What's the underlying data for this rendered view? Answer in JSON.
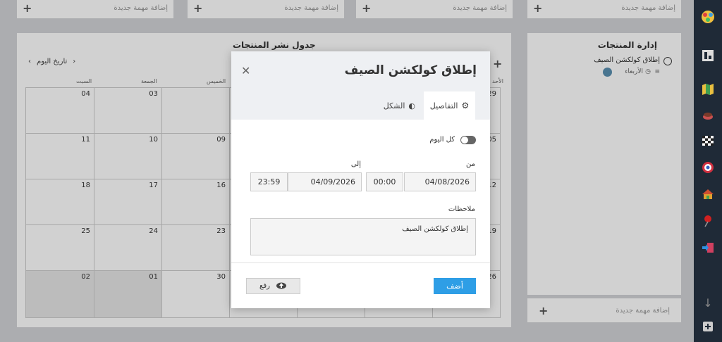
{
  "top_cards": [
    {
      "add_label": "إضافة مهمة جديدة"
    },
    {
      "add_label": "إضافة مهمة جديدة"
    },
    {
      "add_label": "إضافة مهمة جديدة"
    },
    {
      "add_label": "إضافة مهمة جديدة"
    }
  ],
  "calendar": {
    "title": "جدول نشر المنتجات",
    "today_label": "تاريخ اليوم",
    "day_headers": [
      "السبت",
      "الجمعة",
      "الخميس",
      "الأحد"
    ],
    "dates": [
      [
        "04",
        "03",
        "",
        "",
        "",
        "",
        "29"
      ],
      [
        "11",
        "10",
        "09",
        "",
        "",
        "",
        "05"
      ],
      [
        "18",
        "17",
        "16",
        "",
        "",
        "",
        "12"
      ],
      [
        "25",
        "24",
        "23",
        "",
        "",
        "",
        "19"
      ],
      [
        "02",
        "01",
        "30",
        "",
        "",
        "",
        "26"
      ]
    ]
  },
  "product_management": {
    "title": "إدارة المنتجات",
    "task": {
      "title": "إطلاق كولكشن الصيف",
      "meta": "الأربعاء"
    },
    "add_label": "إضافة مهمة جديدة"
  },
  "modal": {
    "title": "إطلاق كولكشن الصيف",
    "tabs": {
      "details": "التفاصيل",
      "appearance": "الشكل"
    },
    "all_day_label": "كل اليوم",
    "from_label": "من",
    "to_label": "إلى",
    "from_date": "04/08/2026",
    "from_time": "00:00",
    "to_date": "04/09/2026",
    "to_time": "23:59",
    "notes_label": "ملاحظات",
    "notes_value": "إطلاق كولكشن الصيف",
    "add_button": "أضف",
    "upload_button": "رفع"
  },
  "colors": {
    "accent": "#2e9ee6",
    "sidebar": "#1f2a37"
  }
}
